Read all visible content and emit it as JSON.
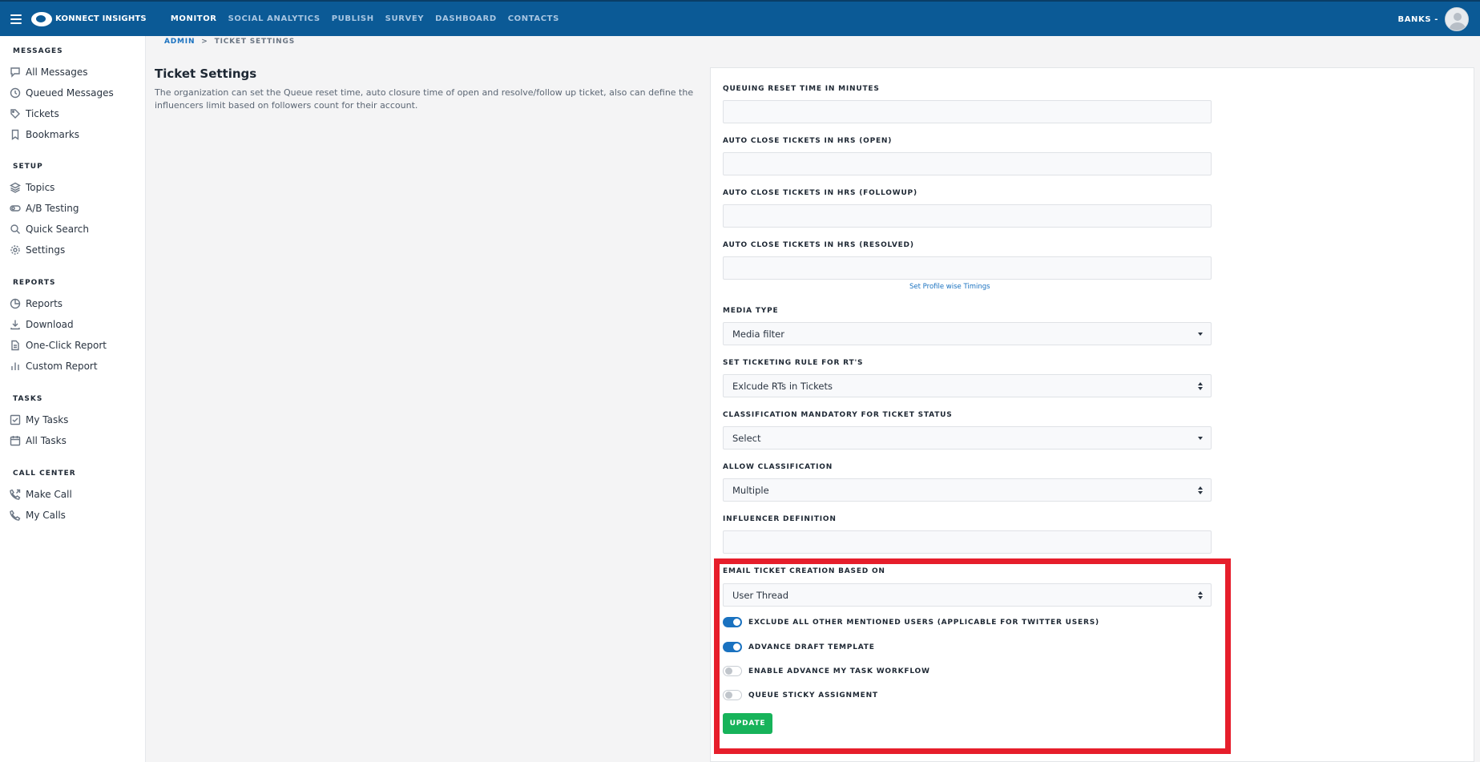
{
  "header": {
    "brand": "KONNECT INSIGHTS",
    "nav": [
      "MONITOR",
      "SOCIAL ANALYTICS",
      "PUBLISH",
      "SURVEY",
      "DASHBOARD",
      "CONTACTS"
    ],
    "user": "BANKS -"
  },
  "sidebar": {
    "sections": [
      {
        "title": "MESSAGES",
        "items": [
          {
            "label": "All Messages",
            "icon": "message-icon"
          },
          {
            "label": "Queued Messages",
            "icon": "clock-icon"
          },
          {
            "label": "Tickets",
            "icon": "tag-icon"
          },
          {
            "label": "Bookmarks",
            "icon": "bookmark-icon"
          }
        ]
      },
      {
        "title": "SETUP",
        "items": [
          {
            "label": "Topics",
            "icon": "layers-icon"
          },
          {
            "label": "A/B Testing",
            "icon": "toggle-icon"
          },
          {
            "label": "Quick Search",
            "icon": "search-icon"
          },
          {
            "label": "Settings",
            "icon": "gear-icon"
          }
        ]
      },
      {
        "title": "REPORTS",
        "items": [
          {
            "label": "Reports",
            "icon": "pie-chart-icon"
          },
          {
            "label": "Download",
            "icon": "download-icon"
          },
          {
            "label": "One-Click Report",
            "icon": "document-icon"
          },
          {
            "label": "Custom Report",
            "icon": "bar-chart-icon"
          }
        ]
      },
      {
        "title": "TASKS",
        "items": [
          {
            "label": "My Tasks",
            "icon": "checkbox-icon"
          },
          {
            "label": "All Tasks",
            "icon": "calendar-icon"
          }
        ]
      },
      {
        "title": "CALL CENTER",
        "items": [
          {
            "label": "Make Call",
            "icon": "phone-out-icon"
          },
          {
            "label": "My Calls",
            "icon": "phone-icon"
          }
        ]
      }
    ]
  },
  "breadcrumb": {
    "root": "ADMIN",
    "sep": ">",
    "current": "TICKET SETTINGS"
  },
  "page": {
    "title": "Ticket Settings",
    "description": "The organization can set the Queue reset time, auto closure time of open and resolve/follow up ticket, also can define the influencers limit based on followers count for their account."
  },
  "form": {
    "queue_reset_label": "QUEUING RESET TIME IN MINUTES",
    "queue_reset_value": "",
    "auto_close_open_label": "AUTO CLOSE TICKETS IN HRS (OPEN)",
    "auto_close_open_value": "",
    "auto_close_followup_label": "AUTO CLOSE TICKETS IN HRS (FOLLOWUP)",
    "auto_close_followup_value": "",
    "auto_close_resolved_label": "AUTO CLOSE TICKETS IN HRS (RESOLVED)",
    "auto_close_resolved_value": "",
    "profile_timings_link": "Set Profile wise Timings",
    "media_type_label": "MEDIA TYPE",
    "media_type_value": "Media filter",
    "rt_rule_label": "SET TICKETING RULE FOR RT'S",
    "rt_rule_value": "Exlcude RTs in Tickets",
    "classification_mandatory_label": "CLASSIFICATION MANDATORY FOR TICKET STATUS",
    "classification_mandatory_value": "Select",
    "allow_classification_label": "ALLOW CLASSIFICATION",
    "allow_classification_value": "Multiple",
    "influencer_label": "INFLUENCER DEFINITION",
    "influencer_value": "",
    "email_ticket_label": "EMAIL TICKET CREATION BASED ON",
    "email_ticket_value": "User Thread",
    "toggles": [
      {
        "label": "EXCLUDE ALL OTHER MENTIONED USERS (APPLICABLE FOR TWITTER USERS)",
        "on": true
      },
      {
        "label": "ADVANCE DRAFT TEMPLATE",
        "on": true
      },
      {
        "label": "ENABLE ADVANCE MY TASK WORKFLOW",
        "on": false
      },
      {
        "label": "QUEUE STICKY ASSIGNMENT",
        "on": false
      }
    ],
    "update_label": "UPDATE"
  },
  "colors": {
    "header": "#0b5a96",
    "accent": "#1a72c0",
    "update": "#17b35a",
    "highlight": "#e61e2b"
  }
}
